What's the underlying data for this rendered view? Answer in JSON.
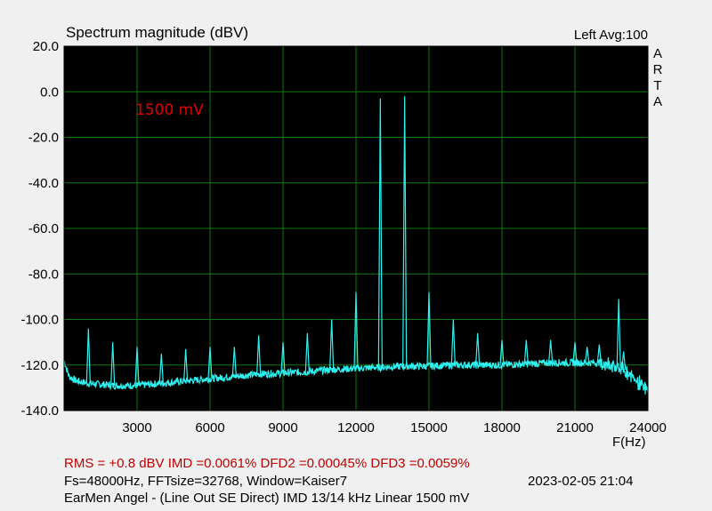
{
  "header": {
    "title": "Spectrum magnitude (dBV)",
    "channel_info": "Left  Avg:100",
    "brand_letters": [
      "A",
      "R",
      "T",
      "A"
    ]
  },
  "footer": {
    "measurements": "RMS =   +0.8 dBV   IMD =0.0061%   DFD2 =0.00045%   DFD3 =0.0059%",
    "params": "Fs=48000Hz, FFTsize=32768, Window=Kaiser7",
    "timestamp": "2023-02-05  21:04",
    "description": "EarMen Angel - (Line Out SE Direct) IMD 13/14 kHz Linear 1500 mV"
  },
  "colors": {
    "plot_bg": "#000000",
    "grid": "#0c7a0c",
    "trace": "#2ef2f2",
    "annotation": "#e00000",
    "measurement_text": "#c00000"
  },
  "chart_data": {
    "type": "line",
    "ylabel": "",
    "xlabel": "F(Hz)",
    "xlim": [
      0,
      24000
    ],
    "ylim": [
      -140,
      20
    ],
    "x_ticks": [
      3000,
      6000,
      9000,
      12000,
      15000,
      18000,
      21000,
      24000
    ],
    "x_tick_labels": [
      "3000",
      "6000",
      "9000",
      "12000",
      "15000",
      "18000",
      "21000",
      "24000"
    ],
    "y_ticks": [
      20,
      0,
      -20,
      -40,
      -60,
      -80,
      -100,
      -120,
      -140
    ],
    "y_tick_labels": [
      "20.0",
      "0.0",
      "-20.0",
      "-40.0",
      "-60.0",
      "-80.0",
      "-100.0",
      "-120.0",
      "-140.0"
    ],
    "grid": true,
    "annotation": {
      "text": "1500 mV",
      "x": 3000,
      "y": -10
    },
    "noise_floor": [
      [
        0,
        -118
      ],
      [
        200,
        -125
      ],
      [
        500,
        -127
      ],
      [
        1000,
        -128
      ],
      [
        2000,
        -129
      ],
      [
        3000,
        -129
      ],
      [
        4000,
        -128
      ],
      [
        5000,
        -127
      ],
      [
        6000,
        -126
      ],
      [
        7000,
        -125
      ],
      [
        8000,
        -124
      ],
      [
        9000,
        -123.5
      ],
      [
        10000,
        -123
      ],
      [
        11000,
        -122
      ],
      [
        12000,
        -121.5
      ],
      [
        13000,
        -121
      ],
      [
        14000,
        -120.5
      ],
      [
        15000,
        -120.5
      ],
      [
        16000,
        -120
      ],
      [
        17000,
        -120
      ],
      [
        18000,
        -120
      ],
      [
        19000,
        -119.5
      ],
      [
        20000,
        -119
      ],
      [
        21000,
        -119
      ],
      [
        22000,
        -119
      ],
      [
        22500,
        -120
      ],
      [
        23000,
        -122
      ],
      [
        23500,
        -126
      ],
      [
        24000,
        -132
      ]
    ],
    "peaks": [
      {
        "x": 13000,
        "y": -3
      },
      {
        "x": 14000,
        "y": -2
      },
      {
        "x": 1000,
        "y": -104
      },
      {
        "x": 12000,
        "y": -88
      },
      {
        "x": 15000,
        "y": -88
      },
      {
        "x": 11000,
        "y": -100
      },
      {
        "x": 16000,
        "y": -100
      },
      {
        "x": 22800,
        "y": -91
      },
      {
        "x": 2000,
        "y": -110
      },
      {
        "x": 3000,
        "y": -112
      },
      {
        "x": 4000,
        "y": -115
      },
      {
        "x": 5000,
        "y": -113
      },
      {
        "x": 6000,
        "y": -112
      },
      {
        "x": 7000,
        "y": -112
      },
      {
        "x": 8000,
        "y": -107
      },
      {
        "x": 9000,
        "y": -110
      },
      {
        "x": 10000,
        "y": -106
      },
      {
        "x": 17000,
        "y": -106
      },
      {
        "x": 18000,
        "y": -109
      },
      {
        "x": 19000,
        "y": -109
      },
      {
        "x": 20000,
        "y": -109
      },
      {
        "x": 21000,
        "y": -110
      },
      {
        "x": 21500,
        "y": -112
      },
      {
        "x": 22000,
        "y": -111
      },
      {
        "x": 23000,
        "y": -114
      }
    ]
  }
}
